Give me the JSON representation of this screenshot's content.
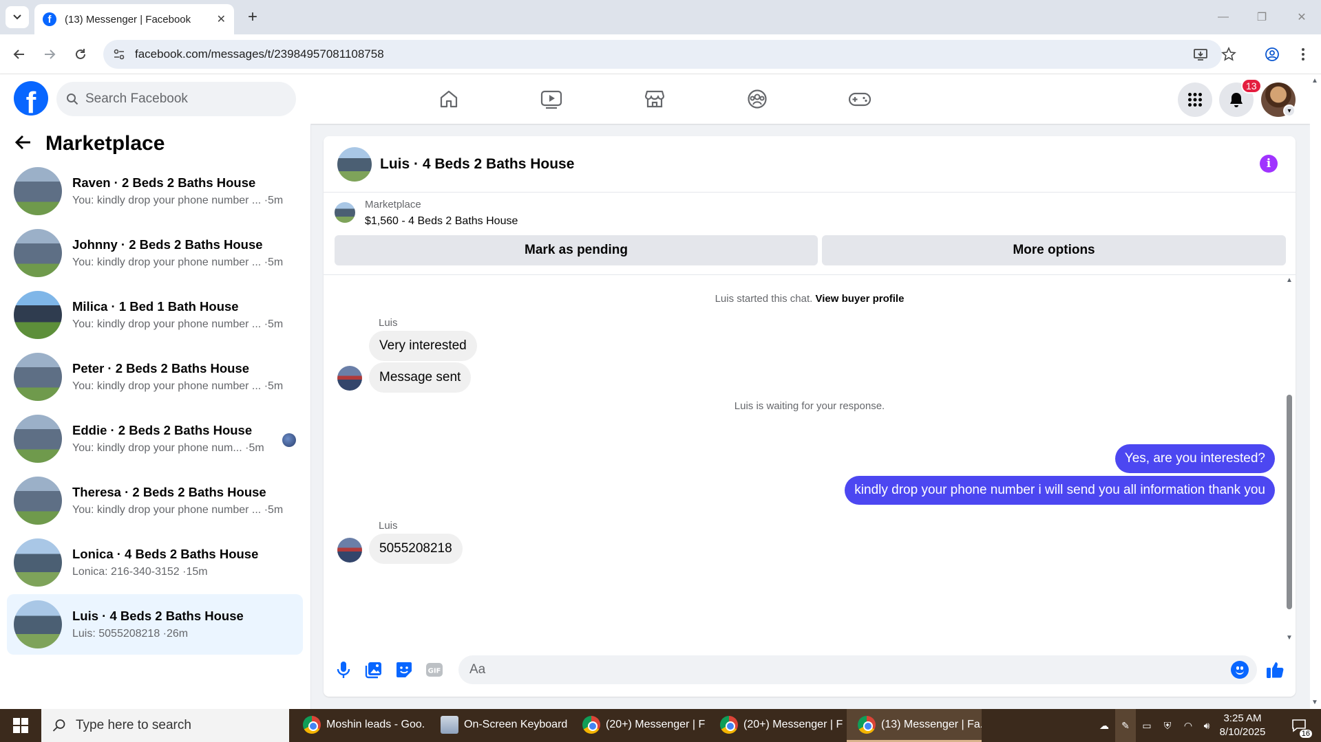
{
  "browser": {
    "tab_title": "(13) Messenger | Facebook",
    "url": "facebook.com/messages/t/23984957081108758"
  },
  "fb": {
    "logo_letter": "f",
    "search_placeholder": "Search Facebook",
    "notification_count": "13"
  },
  "sidebar": {
    "title": "Marketplace",
    "conversations": [
      {
        "name": "Raven · 2 Beds 2 Baths House",
        "preview": "You: kindly drop your phone number ... ·5m"
      },
      {
        "name": "Johnny · 2 Beds 2 Baths House",
        "preview": "You: kindly drop your phone number ... ·5m"
      },
      {
        "name": "Milica · 1 Bed 1 Bath House",
        "preview": "You: kindly drop your phone number ... ·5m"
      },
      {
        "name": "Peter · 2 Beds 2 Baths House",
        "preview": "You: kindly drop your phone number ... ·5m"
      },
      {
        "name": "Eddie · 2 Beds 2 Baths House",
        "preview": "You: kindly drop your phone num... ·5m"
      },
      {
        "name": "Theresa · 2 Beds 2 Baths House",
        "preview": "You: kindly drop your phone number ... ·5m"
      },
      {
        "name": "Lonica · 4 Beds 2 Baths House",
        "preview": "Lonica: 216-340-3152 ·15m"
      },
      {
        "name": "Luis · 4 Beds 2 Baths House",
        "preview": "Luis: 5055208218 ·26m"
      }
    ]
  },
  "chat": {
    "title": "Luis · 4 Beds 2 Baths House",
    "listing_category": "Marketplace",
    "listing_price": "$1,560 - 4 Beds 2 Baths House",
    "mark_pending_label": "Mark as pending",
    "more_options_label": "More options",
    "started_text": "Luis started this chat.",
    "view_profile_label": "View buyer profile",
    "sender_name": "Luis",
    "incoming_1": "Very interested",
    "incoming_2": "Message sent",
    "waiting_text": "Luis is waiting for your response.",
    "outgoing_1": "Yes, are you interested?",
    "outgoing_2": "kindly drop your phone number i will send you all information thank you",
    "sender_name_2": "Luis",
    "incoming_3": "5055208218",
    "composer_placeholder": "Aa",
    "gif_label": "GIF"
  },
  "taskbar": {
    "search_placeholder": "Type here to search",
    "apps": [
      {
        "label": "Moshin leads - Goo..."
      },
      {
        "label": "On-Screen Keyboard"
      },
      {
        "label": "(20+) Messenger | F..."
      },
      {
        "label": "(20+) Messenger | F..."
      },
      {
        "label": "(13) Messenger | Fa..."
      }
    ],
    "time": "3:25 AM",
    "date": "8/10/2025",
    "notif_count": "16"
  },
  "colors": {
    "fb_blue": "#0866ff",
    "outgoing_bubble": "#4c47f1",
    "active_conv_bg": "#ebf5ff",
    "badge_red": "#e41e3f"
  }
}
